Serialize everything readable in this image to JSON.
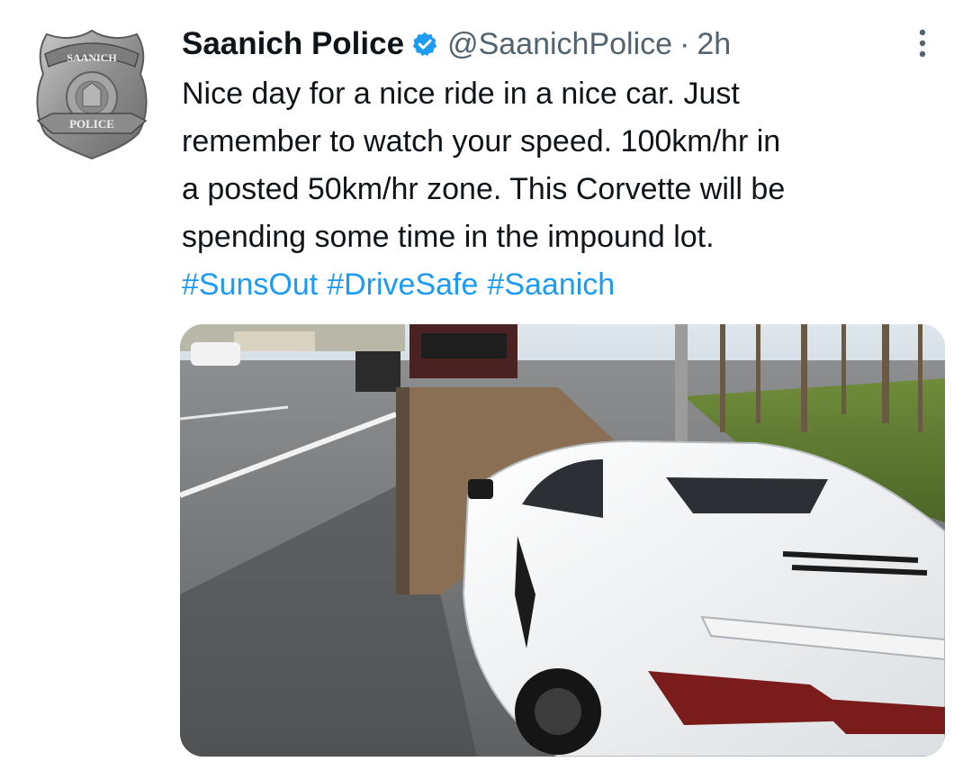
{
  "tweet": {
    "author_name": "Saanich Police",
    "handle": "@SaanichPolice",
    "separator": "·",
    "time": "2h",
    "badge": {
      "top_text": "SAANICH",
      "bottom_text": "POLICE"
    },
    "text_lines": [
      "Nice day for a nice ride in a nice car. Just",
      "remember to watch your speed. 100km/hr in",
      "a posted 50km/hr zone. This Corvette will be",
      "spending some time in the impound lot."
    ],
    "hashtags": [
      "#SunsOut",
      "#DriveSafe",
      "#Saanich"
    ],
    "icons": {
      "verified": "verified-badge-icon",
      "more": "more-options-icon"
    },
    "colors": {
      "text": "#0f1419",
      "secondary": "#536471",
      "link": "#1d9bf0",
      "verified": "#1d9bf0"
    }
  }
}
